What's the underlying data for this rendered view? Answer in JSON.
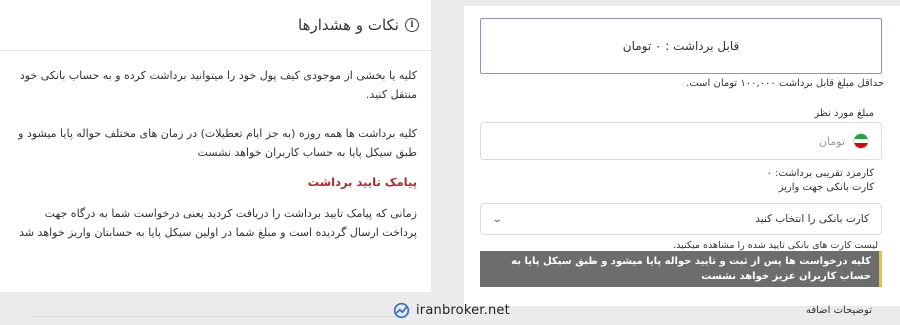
{
  "form": {
    "balance_text": "قابل برداشت : ۰ تومان",
    "min_note": "حداقل مبلغ قابل برداشت ۱۰۰,۰۰۰ تومان است.",
    "amount_label": "مبلغ مورد نظر",
    "amount_placeholder": "تومان",
    "fee_text": "کارمزد تقریبی برداشت: ۰",
    "card_label": "کارت بانکی جهت واریز",
    "card_select_value": "کارت بانکی را انتخاب کنید",
    "card_note": "لیست کارت های بانکی تایید شده را مشاهده میکنید.",
    "notice_text": "کلیه درخواست ها پس از ثبت و تایید حواله پایا میشود و طبق سیکل پایا به حساب کاربران عزیز خواهد نشست",
    "extra_label": "توضیحات اضافه"
  },
  "notes": {
    "title": "نکات و هشدارها",
    "paragraph1": "کلیه یا بخشی از موجودی کیف پول خود را میتوانید برداشت کرده و به حساب بانکی خود منتقل کنید.",
    "paragraph2": "کلیه برداشت ها همه روزه (به جز ایام تعطیلات) در زمان های مختلف حواله پایا میشود و طبق سیکل پایا به حساب کاربران خواهد نشست",
    "sms_title": "پیامک تایید برداشت",
    "paragraph3": "زمانی که پیامک تایید برداشت را دریافت کردید یعنی درخواست شما به درگاه جهت پرداخت ارسال گردیده است و مبلغ شما در اولین سیکل پایا به حسابتان واریز خواهد شد"
  },
  "watermark": {
    "text": "iranbroker.net"
  },
  "colors": {
    "notice_bg": "#6d6d6d",
    "notice_accent": "#f0c21b",
    "sms_title": "#b8262b",
    "balance_border": "#8e8fd0",
    "logo": "#2f6fd0"
  },
  "icons": {
    "flag": "iran-flag-icon",
    "chevron": "chevron-down-icon",
    "info": "info-icon",
    "logo": "iranbroker-logo-icon"
  }
}
